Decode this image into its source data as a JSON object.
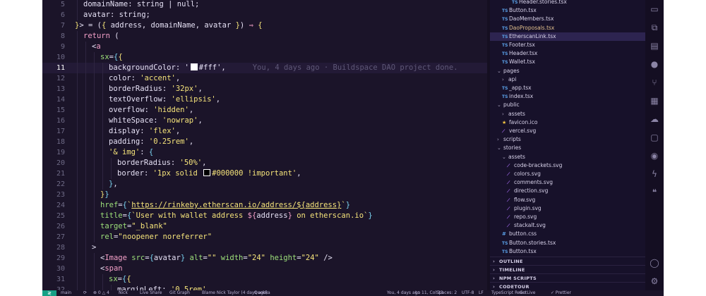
{
  "editor": {
    "lines": [
      {
        "n": "5",
        "indent": 1,
        "tokens": [
          [
            "pr",
            "domainName"
          ],
          [
            "t",
            ": string | null;"
          ]
        ]
      },
      {
        "n": "6",
        "indent": 1,
        "tokens": [
          [
            "pr",
            "avatar"
          ],
          [
            "t",
            ": string;"
          ]
        ]
      },
      {
        "n": "7",
        "indent": 0,
        "tokens": [
          [
            "p",
            "}"
          ],
          [
            "t",
            "> = ("
          ],
          [
            "p",
            "{"
          ],
          [
            "t",
            " address, domainName, avatar "
          ],
          [
            "p",
            "}"
          ],
          [
            "t",
            ") "
          ],
          [
            "k",
            "⇒"
          ],
          [
            "t",
            " "
          ],
          [
            "p",
            "{"
          ]
        ]
      },
      {
        "n": "8",
        "indent": 1,
        "tokens": [
          [
            "k",
            "return"
          ],
          [
            "t",
            " ("
          ]
        ]
      },
      {
        "n": "9",
        "indent": 2,
        "tokens": [
          [
            "t",
            "<"
          ],
          [
            "tag",
            "a"
          ]
        ]
      },
      {
        "n": "10",
        "indent": 3,
        "tokens": [
          [
            "attr",
            "sx"
          ],
          [
            "t",
            "="
          ],
          [
            "b",
            "{"
          ],
          [
            "p",
            "{"
          ]
        ]
      },
      {
        "n": "11",
        "indent": 4,
        "tokens": [
          [
            "pr",
            "backgroundColor"
          ],
          [
            "t",
            ": '"
          ],
          [
            "swatch",
            "#ffffff"
          ],
          [
            "t",
            "#fff',"
          ]
        ],
        "blame": "You, 4 days ago · Buildspace DAO project done.",
        "current": true
      },
      {
        "n": "12",
        "indent": 4,
        "tokens": [
          [
            "pr",
            "color"
          ],
          [
            "t",
            ": "
          ],
          [
            "s",
            "'accent'"
          ],
          [
            "t",
            ","
          ]
        ]
      },
      {
        "n": "13",
        "indent": 4,
        "tokens": [
          [
            "pr",
            "borderRadius"
          ],
          [
            "t",
            ": "
          ],
          [
            "s",
            "'32px'"
          ],
          [
            "t",
            ","
          ]
        ]
      },
      {
        "n": "14",
        "indent": 4,
        "tokens": [
          [
            "pr",
            "textOverflow"
          ],
          [
            "t",
            ": "
          ],
          [
            "s",
            "'ellipsis'"
          ],
          [
            "t",
            ","
          ]
        ]
      },
      {
        "n": "15",
        "indent": 4,
        "tokens": [
          [
            "pr",
            "overflow"
          ],
          [
            "t",
            ": "
          ],
          [
            "s",
            "'hidden'"
          ],
          [
            "t",
            ","
          ]
        ]
      },
      {
        "n": "16",
        "indent": 4,
        "tokens": [
          [
            "pr",
            "whiteSpace"
          ],
          [
            "t",
            ": "
          ],
          [
            "s",
            "'nowrap'"
          ],
          [
            "t",
            ","
          ]
        ]
      },
      {
        "n": "17",
        "indent": 4,
        "tokens": [
          [
            "pr",
            "display"
          ],
          [
            "t",
            ": "
          ],
          [
            "s",
            "'flex'"
          ],
          [
            "t",
            ","
          ]
        ]
      },
      {
        "n": "18",
        "indent": 4,
        "tokens": [
          [
            "pr",
            "padding"
          ],
          [
            "t",
            ": "
          ],
          [
            "s",
            "'0.25rem'"
          ],
          [
            "t",
            ","
          ]
        ]
      },
      {
        "n": "19",
        "indent": 4,
        "tokens": [
          [
            "s",
            "'& img'"
          ],
          [
            "t",
            ": "
          ],
          [
            "b",
            "{"
          ]
        ]
      },
      {
        "n": "20",
        "indent": 5,
        "tokens": [
          [
            "pr",
            "borderRadius"
          ],
          [
            "t",
            ": "
          ],
          [
            "s",
            "'50%'"
          ],
          [
            "t",
            ","
          ]
        ]
      },
      {
        "n": "21",
        "indent": 5,
        "tokens": [
          [
            "pr",
            "border"
          ],
          [
            "t",
            ": "
          ],
          [
            "s",
            "'1px solid "
          ],
          [
            "swatch",
            "#000000"
          ],
          [
            "s",
            "#000000 !important'"
          ],
          [
            "t",
            ","
          ]
        ]
      },
      {
        "n": "22",
        "indent": 4,
        "tokens": [
          [
            "b",
            "}"
          ],
          [
            "t",
            ","
          ]
        ]
      },
      {
        "n": "23",
        "indent": 3,
        "tokens": [
          [
            "p",
            "}"
          ],
          [
            "b",
            "}"
          ]
        ]
      },
      {
        "n": "24",
        "indent": 3,
        "tokens": [
          [
            "attr",
            "href"
          ],
          [
            "t",
            "="
          ],
          [
            "b",
            "{"
          ],
          [
            "s",
            "`"
          ],
          [
            "u",
            "https://rinkeby.etherscan.io/address/${address}"
          ],
          [
            "s",
            "`"
          ],
          [
            "b",
            "}"
          ]
        ]
      },
      {
        "n": "25",
        "indent": 3,
        "tokens": [
          [
            "attr",
            "title"
          ],
          [
            "t",
            "="
          ],
          [
            "b",
            "{"
          ],
          [
            "s",
            "`User with wallet address "
          ],
          [
            "k",
            "${"
          ],
          [
            "t",
            "address"
          ],
          [
            "k",
            "}"
          ],
          [
            "s",
            " on etherscan.io`"
          ],
          [
            "b",
            "}"
          ]
        ]
      },
      {
        "n": "26",
        "indent": 3,
        "tokens": [
          [
            "attr",
            "target"
          ],
          [
            "t",
            "="
          ],
          [
            "s",
            "\"_blank\""
          ]
        ]
      },
      {
        "n": "27",
        "indent": 3,
        "tokens": [
          [
            "attr",
            "rel"
          ],
          [
            "t",
            "="
          ],
          [
            "s",
            "\"noopener noreferrer\""
          ]
        ]
      },
      {
        "n": "28",
        "indent": 2,
        "tokens": [
          [
            "t",
            ">"
          ]
        ]
      },
      {
        "n": "29",
        "indent": 3,
        "tokens": [
          [
            "t",
            "<"
          ],
          [
            "tag",
            "Image"
          ],
          [
            "t",
            " "
          ],
          [
            "attr",
            "src"
          ],
          [
            "t",
            "="
          ],
          [
            "b",
            "{"
          ],
          [
            "t",
            "avatar"
          ],
          [
            "b",
            "}"
          ],
          [
            "t",
            " "
          ],
          [
            "attr",
            "alt"
          ],
          [
            "t",
            "="
          ],
          [
            "s",
            "\"\""
          ],
          [
            "t",
            " "
          ],
          [
            "attr",
            "width"
          ],
          [
            "t",
            "="
          ],
          [
            "s",
            "\"24\""
          ],
          [
            "t",
            " "
          ],
          [
            "attr",
            "height"
          ],
          [
            "t",
            "="
          ],
          [
            "s",
            "\"24\""
          ],
          [
            "t",
            " />"
          ]
        ]
      },
      {
        "n": "30",
        "indent": 3,
        "tokens": [
          [
            "t",
            "<"
          ],
          [
            "tag",
            "span"
          ]
        ]
      },
      {
        "n": "31",
        "indent": 4,
        "tokens": [
          [
            "attr",
            "sx"
          ],
          [
            "t",
            "="
          ],
          [
            "b",
            "{"
          ],
          [
            "p",
            "{"
          ]
        ]
      },
      {
        "n": "32",
        "indent": 5,
        "tokens": [
          [
            "pr",
            "marginLeft"
          ],
          [
            "t",
            ": "
          ],
          [
            "s",
            "'0.5rem'"
          ],
          [
            "t",
            ","
          ]
        ]
      }
    ]
  },
  "explorer": {
    "rows": [
      {
        "kind": "file",
        "icon": "ts",
        "label": "Header.stories.tsx",
        "depth": 3,
        "partial": true
      },
      {
        "kind": "file",
        "icon": "ts",
        "label": "Button.tsx",
        "depth": 1
      },
      {
        "kind": "file",
        "icon": "ts",
        "label": "DaoMembers.tsx",
        "depth": 1
      },
      {
        "kind": "file",
        "icon": "ts",
        "label": "DaoProposals.tsx",
        "depth": 1,
        "modified": true,
        "badge": "4"
      },
      {
        "kind": "file",
        "icon": "ts",
        "label": "EtherscanLink.tsx",
        "depth": 1,
        "selected": true
      },
      {
        "kind": "file",
        "icon": "ts",
        "label": "Footer.tsx",
        "depth": 1
      },
      {
        "kind": "file",
        "icon": "ts",
        "label": "Header.tsx",
        "depth": 1
      },
      {
        "kind": "file",
        "icon": "ts",
        "label": "Wallet.tsx",
        "depth": 1
      },
      {
        "kind": "folder-open",
        "label": "pages",
        "depth": 0
      },
      {
        "kind": "folder",
        "label": "api",
        "depth": 1
      },
      {
        "kind": "file",
        "icon": "ts",
        "label": "_app.tsx",
        "depth": 1
      },
      {
        "kind": "file",
        "icon": "ts",
        "label": "index.tsx",
        "depth": 1
      },
      {
        "kind": "folder-open",
        "label": "public",
        "depth": 0
      },
      {
        "kind": "folder",
        "label": "assets",
        "depth": 1
      },
      {
        "kind": "file",
        "icon": "star",
        "label": "favicon.ico",
        "depth": 1
      },
      {
        "kind": "file",
        "icon": "svg",
        "label": "vercel.svg",
        "depth": 1
      },
      {
        "kind": "folder",
        "label": "scripts",
        "depth": 0
      },
      {
        "kind": "folder-open",
        "label": "stories",
        "depth": 0
      },
      {
        "kind": "folder-open",
        "label": "assets",
        "depth": 1
      },
      {
        "kind": "file",
        "icon": "svg",
        "label": "code-brackets.svg",
        "depth": 2
      },
      {
        "kind": "file",
        "icon": "svg",
        "label": "colors.svg",
        "depth": 2
      },
      {
        "kind": "file",
        "icon": "svg",
        "label": "comments.svg",
        "depth": 2
      },
      {
        "kind": "file",
        "icon": "svg",
        "label": "direction.svg",
        "depth": 2
      },
      {
        "kind": "file",
        "icon": "svg",
        "label": "flow.svg",
        "depth": 2
      },
      {
        "kind": "file",
        "icon": "svg",
        "label": "plugin.svg",
        "depth": 2
      },
      {
        "kind": "file",
        "icon": "svg",
        "label": "repo.svg",
        "depth": 2
      },
      {
        "kind": "file",
        "icon": "svg",
        "label": "stackalt.svg",
        "depth": 2
      },
      {
        "kind": "file",
        "icon": "css",
        "label": "button.css",
        "depth": 1
      },
      {
        "kind": "file",
        "icon": "ts",
        "label": "Button.stories.tsx",
        "depth": 1
      },
      {
        "kind": "file",
        "icon": "ts",
        "label": "Button.tsx",
        "depth": 1
      }
    ],
    "sections": [
      "OUTLINE",
      "TIMELINE",
      "NPM SCRIPTS",
      "CODETOUR"
    ]
  },
  "activity_icons": [
    "remote-explorer-icon",
    "extensions-icon",
    "panel-icon",
    "github-icon",
    "source-control-icon",
    "database-icon",
    "docker-icon",
    "folder-icon",
    "gitlens-icon",
    "lightning-icon",
    "quote-icon",
    "account-icon",
    "settings-icon"
  ],
  "statusbar": {
    "remote": "≷",
    "items": [
      {
        "name": "branch",
        "text": "main"
      },
      {
        "name": "sync",
        "text": "⟳"
      },
      {
        "name": "problems",
        "text": "⊗ 0 △ 4"
      },
      {
        "name": "user",
        "text": "Nick"
      },
      {
        "name": "live-share",
        "text": "Live Share"
      },
      {
        "name": "graph",
        "text": "Git Graph"
      },
      {
        "name": "blame",
        "text": "Blame Nick Taylor (4 days ago)"
      },
      {
        "name": "quokka",
        "text": "Quokka"
      },
      {
        "name": "git-blame-line",
        "text": "You, 4 days ago"
      },
      {
        "name": "cursor-pos",
        "text": "Ln 11, Col 33"
      },
      {
        "name": "spaces",
        "text": "Spaces: 2"
      },
      {
        "name": "encoding",
        "text": "UTF-8"
      },
      {
        "name": "eol",
        "text": "LF"
      },
      {
        "name": "language",
        "text": "TypeScript React"
      },
      {
        "name": "go-live",
        "text": "Go Live"
      },
      {
        "name": "prettier",
        "text": "✓ Prettier"
      }
    ]
  },
  "colors": {
    "editor_bg": "#1b1429",
    "explorer_bg": "#17112a",
    "selection": "#2d2450",
    "keyword": "#f3a0c8",
    "string": "#f5e37a",
    "attribute": "#9de07a",
    "ts_icon": "#5aa0e8",
    "modified": "#e2c08d",
    "remote": "#16a085"
  }
}
